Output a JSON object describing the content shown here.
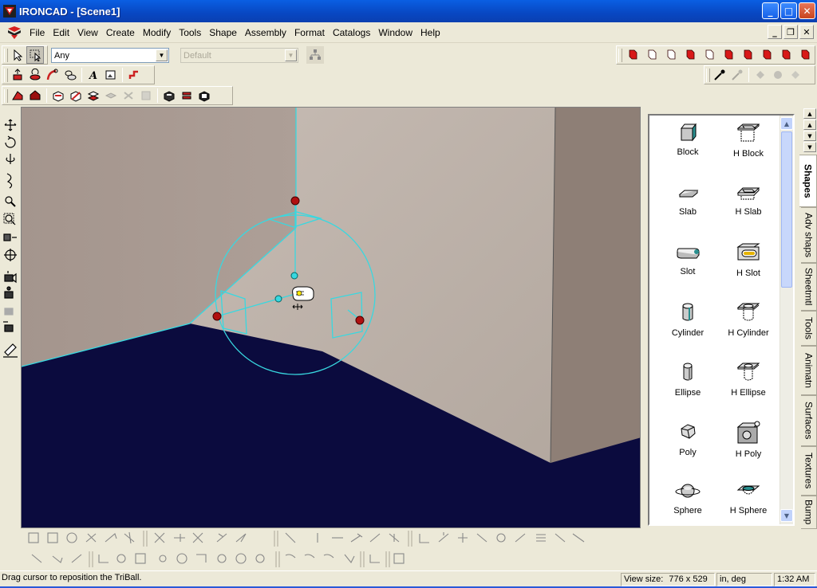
{
  "window": {
    "title": "IRONCAD - [Scene1]",
    "min": "_",
    "max": "□",
    "close": "✕"
  },
  "menu": {
    "items": [
      "File",
      "Edit",
      "View",
      "Create",
      "Modify",
      "Tools",
      "Shape",
      "Assembly",
      "Format",
      "Catalogs",
      "Window",
      "Help"
    ]
  },
  "toolbar": {
    "filter_value": "Any",
    "style_value": "Default"
  },
  "catalog": {
    "items": [
      "Block",
      "H Block",
      "Slab",
      "H Slab",
      "Slot",
      "H Slot",
      "Cylinder",
      "H Cylinder",
      "Ellipse",
      "H Ellipse",
      "Poly",
      "H Poly",
      "Sphere",
      "H Sphere"
    ],
    "tabs": [
      "Shapes",
      "Adv shaps",
      "Sheetmtl",
      "Tools",
      "Animatn",
      "Surfaces",
      "Textures",
      "Bump"
    ],
    "active_tab": "Shapes"
  },
  "status": {
    "message": "Drag cursor to reposition the TriBall.",
    "view_size_label": "View size:",
    "view_size_value": "776 x 529",
    "units": "in, deg",
    "clock": "1:32 AM"
  },
  "colors": {
    "titlebar": "#0a5fe3",
    "floor": "#0b0b3e",
    "wall": "#b5aaa2",
    "triball": "#38d8e0",
    "handle": "#b01010"
  },
  "icons": {
    "left_toolbar": [
      "move-icon",
      "rotate-icon",
      "spin-icon",
      "orbit-icon",
      "zoom-icon",
      "zoom-window-icon",
      "look-at-icon",
      "fit-icon",
      "camera-icon",
      "walk-icon",
      "fly-icon",
      "light-icon",
      "eraser-icon"
    ]
  }
}
